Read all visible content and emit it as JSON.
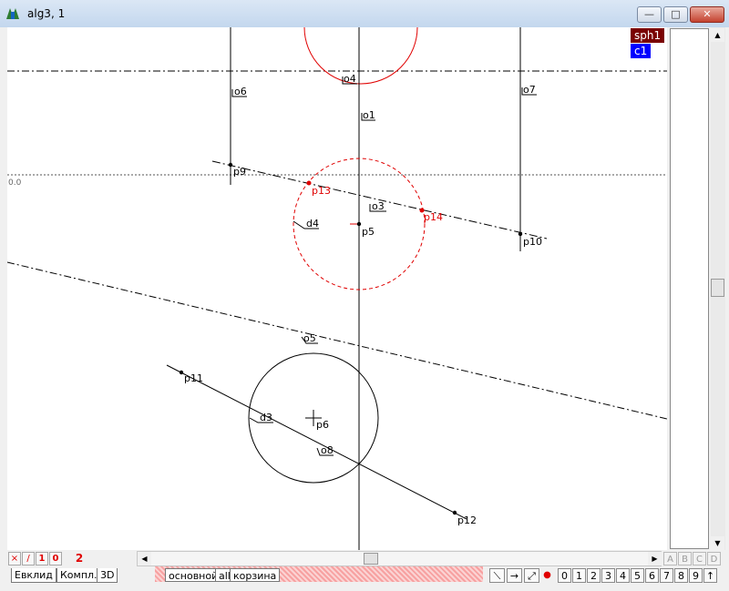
{
  "window": {
    "title": "alg3, 1",
    "min": "—",
    "max": "□",
    "close": "✕"
  },
  "tags": {
    "sph1": "sph1",
    "c1": "c1",
    "colors": {
      "sph1": "#7a0000",
      "c1": "#0000ff"
    }
  },
  "axis_label": "0.0",
  "labels": {
    "o1": "o1",
    "o3": "o3",
    "o4": "o4",
    "o5": "o5",
    "o6": "o6",
    "o7": "o7",
    "o8": "o8",
    "p5": "p5",
    "p6": "p6",
    "p9": "p9",
    "p10": "p10",
    "p11": "p11",
    "p12": "p12",
    "p13": "p13",
    "p14": "p14",
    "d3": "d3",
    "d4": "d4"
  },
  "toolbar_left": {
    "x": "×",
    "slash": "/",
    "one": "1",
    "zero": "0",
    "two": "2"
  },
  "abcd": [
    "A",
    "B",
    "C",
    "D"
  ],
  "tabs": {
    "euclid": "Евклид",
    "compl": "Компл.",
    "d3": "3D"
  },
  "layers": {
    "main": "основной",
    "all": "all",
    "trash": "корзина"
  },
  "tool_icons": {
    "segment": "⟍",
    "arrow": "→",
    "expand": "⤢",
    "dot": "●"
  },
  "digits": [
    "0",
    "1",
    "2",
    "3",
    "4",
    "5",
    "6",
    "7",
    "8",
    "9"
  ],
  "up_arrow": "↑",
  "scroll": {
    "left": "◀",
    "right": "▶",
    "up": "▲",
    "down": "▼"
  }
}
